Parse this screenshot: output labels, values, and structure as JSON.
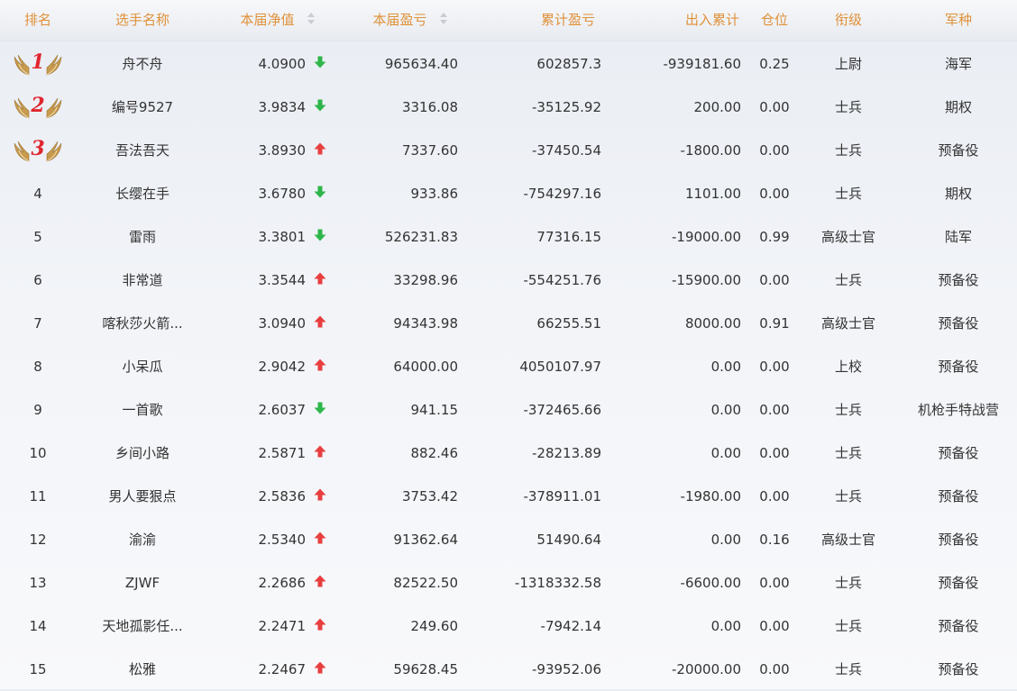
{
  "colors": {
    "header_text": "#e0913a",
    "up": "#e83e3e",
    "down": "#2db64a",
    "medal_number": "#e0262f",
    "wing": "#c79a4e"
  },
  "headers": {
    "rank": "排名",
    "name": "选手名称",
    "nav": "本届净值",
    "pl": "本届盈亏",
    "cum": "累计盈亏",
    "io": "出入累计",
    "pos": "仓位",
    "rank_title": "衔级",
    "arm": "军种"
  },
  "rows": [
    {
      "rank": "1",
      "medal": true,
      "name": "舟不舟",
      "nav": "4.0900",
      "trend": "down",
      "pl": "965634.40",
      "cum": "602857.3",
      "io": "-939181.60",
      "pos": "0.25",
      "rank_title": "上尉",
      "arm": "海军"
    },
    {
      "rank": "2",
      "medal": true,
      "name": "编号9527",
      "nav": "3.9834",
      "trend": "down",
      "pl": "3316.08",
      "cum": "-35125.92",
      "io": "200.00",
      "pos": "0.00",
      "rank_title": "士兵",
      "arm": "期权"
    },
    {
      "rank": "3",
      "medal": true,
      "name": "吾法吾天",
      "nav": "3.8930",
      "trend": "up",
      "pl": "7337.60",
      "cum": "-37450.54",
      "io": "-1800.00",
      "pos": "0.00",
      "rank_title": "士兵",
      "arm": "预备役"
    },
    {
      "rank": "4",
      "medal": false,
      "name": "长缨在手",
      "nav": "3.6780",
      "trend": "down",
      "pl": "933.86",
      "cum": "-754297.16",
      "io": "1101.00",
      "pos": "0.00",
      "rank_title": "士兵",
      "arm": "期权"
    },
    {
      "rank": "5",
      "medal": false,
      "name": "雷雨",
      "nav": "3.3801",
      "trend": "down",
      "pl": "526231.83",
      "cum": "77316.15",
      "io": "-19000.00",
      "pos": "0.99",
      "rank_title": "高级士官",
      "arm": "陆军"
    },
    {
      "rank": "6",
      "medal": false,
      "name": "非常道",
      "nav": "3.3544",
      "trend": "up",
      "pl": "33298.96",
      "cum": "-554251.76",
      "io": "-15900.00",
      "pos": "0.00",
      "rank_title": "士兵",
      "arm": "预备役"
    },
    {
      "rank": "7",
      "medal": false,
      "name": "喀秋莎火箭...",
      "nav": "3.0940",
      "trend": "up",
      "pl": "94343.98",
      "cum": "66255.51",
      "io": "8000.00",
      "pos": "0.91",
      "rank_title": "高级士官",
      "arm": "预备役"
    },
    {
      "rank": "8",
      "medal": false,
      "name": "小呆瓜",
      "nav": "2.9042",
      "trend": "up",
      "pl": "64000.00",
      "cum": "4050107.97",
      "io": "0.00",
      "pos": "0.00",
      "rank_title": "上校",
      "arm": "预备役"
    },
    {
      "rank": "9",
      "medal": false,
      "name": "一首歌",
      "nav": "2.6037",
      "trend": "down",
      "pl": "941.15",
      "cum": "-372465.66",
      "io": "0.00",
      "pos": "0.00",
      "rank_title": "士兵",
      "arm": "机枪手特战营"
    },
    {
      "rank": "10",
      "medal": false,
      "name": "乡间小路",
      "nav": "2.5871",
      "trend": "up",
      "pl": "882.46",
      "cum": "-28213.89",
      "io": "0.00",
      "pos": "0.00",
      "rank_title": "士兵",
      "arm": "预备役"
    },
    {
      "rank": "11",
      "medal": false,
      "name": "男人要狠点",
      "nav": "2.5836",
      "trend": "up",
      "pl": "3753.42",
      "cum": "-378911.01",
      "io": "-1980.00",
      "pos": "0.00",
      "rank_title": "士兵",
      "arm": "预备役"
    },
    {
      "rank": "12",
      "medal": false,
      "name": "渝渝",
      "nav": "2.5340",
      "trend": "up",
      "pl": "91362.64",
      "cum": "51490.64",
      "io": "0.00",
      "pos": "0.16",
      "rank_title": "高级士官",
      "arm": "预备役"
    },
    {
      "rank": "13",
      "medal": false,
      "name": "ZJWF",
      "nav": "2.2686",
      "trend": "up",
      "pl": "82522.50",
      "cum": "-1318332.58",
      "io": "-6600.00",
      "pos": "0.00",
      "rank_title": "士兵",
      "arm": "预备役"
    },
    {
      "rank": "14",
      "medal": false,
      "name": "天地孤影任...",
      "nav": "2.2471",
      "trend": "up",
      "pl": "249.60",
      "cum": "-7942.14",
      "io": "0.00",
      "pos": "0.00",
      "rank_title": "士兵",
      "arm": "预备役"
    },
    {
      "rank": "15",
      "medal": false,
      "name": "松雅",
      "nav": "2.2467",
      "trend": "up",
      "pl": "59628.45",
      "cum": "-93952.06",
      "io": "-20000.00",
      "pos": "0.00",
      "rank_title": "士兵",
      "arm": "预备役"
    }
  ]
}
